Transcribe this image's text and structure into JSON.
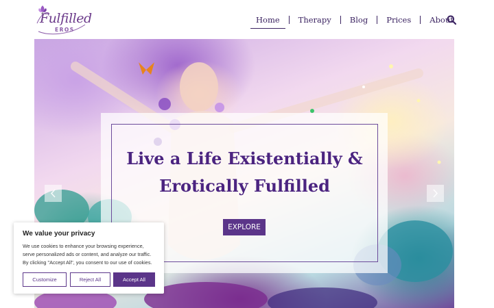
{
  "brand": {
    "logo_script": "Fulfilled",
    "logo_sub": "EROS"
  },
  "nav": {
    "items": [
      {
        "label": "Home",
        "active": true
      },
      {
        "label": "Therapy",
        "active": false
      },
      {
        "label": "Blog",
        "active": false
      },
      {
        "label": "Prices",
        "active": false
      },
      {
        "label": "About",
        "active": false
      }
    ],
    "search_icon": "search-icon"
  },
  "hero": {
    "title_line1": "Live a Life Existentially &",
    "title_line2": "Erotically Fulfilled",
    "button_label": "EXPLORE",
    "prev_icon": "chevron-left-icon",
    "next_icon": "chevron-right-icon"
  },
  "cookie": {
    "title": "We value your privacy",
    "text_line1": "We use cookies to enhance your browsing experience,",
    "text_line2": "serve personalized ads or content, and analyze our traffic.",
    "text_line3": "By clicking \"Accept All\", you consent to our use of cookies.",
    "customize_label": "Customize",
    "reject_label": "Reject All",
    "accept_label": "Accept All"
  },
  "colors": {
    "brand_purple": "#5b3589",
    "nav_text": "#3a2260",
    "title_purple": "#4b2480"
  }
}
